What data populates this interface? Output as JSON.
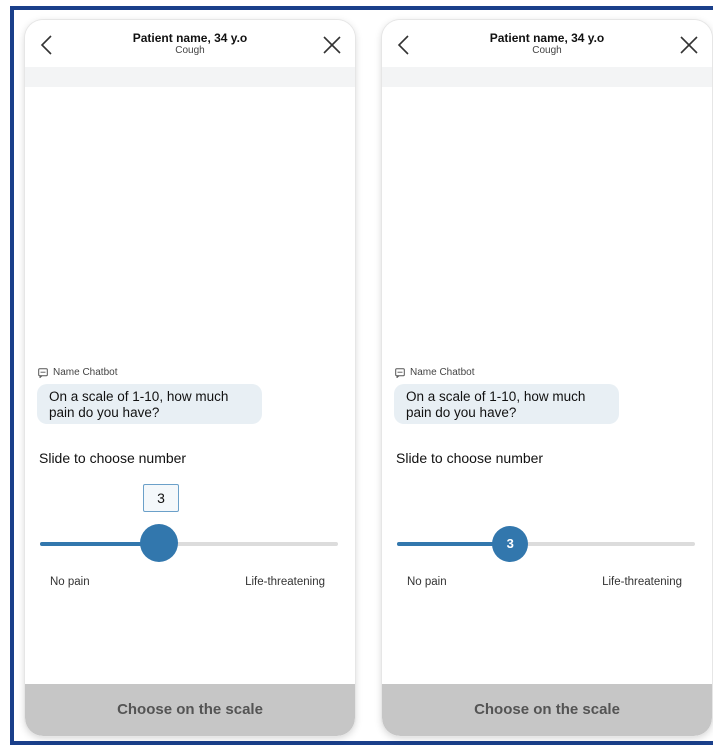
{
  "screens": [
    {
      "header": {
        "title": "Patient name, 34 y.o",
        "subtitle": "Cough"
      },
      "chat": {
        "sender": "Name Chatbot",
        "message": "On a scale of 1-10, how much pain do you have?"
      },
      "prompt": "Slide to choose number",
      "slider": {
        "value": "3",
        "fraction": 0.4,
        "min_label": "No pain",
        "max_label": "Life-threatening"
      },
      "cta": "Choose on the scale"
    },
    {
      "header": {
        "title": "Patient name, 34 y.o",
        "subtitle": "Cough"
      },
      "chat": {
        "sender": "Name Chatbot",
        "message": "On a scale of 1-10, how much pain do you have?"
      },
      "prompt": "Slide to choose number",
      "slider": {
        "value": "3",
        "fraction": 0.38,
        "min_label": "No pain",
        "max_label": "Life-threatening"
      },
      "cta": "Choose on the scale"
    }
  ],
  "colors": {
    "accent": "#3277ad",
    "frame": "#1a3f8a",
    "bubble": "#e8eff4",
    "cta_disabled": "#c6c6c6"
  },
  "icons": {
    "back": "chevron-left-icon",
    "close": "close-icon",
    "chatbot": "chatbot-icon"
  }
}
